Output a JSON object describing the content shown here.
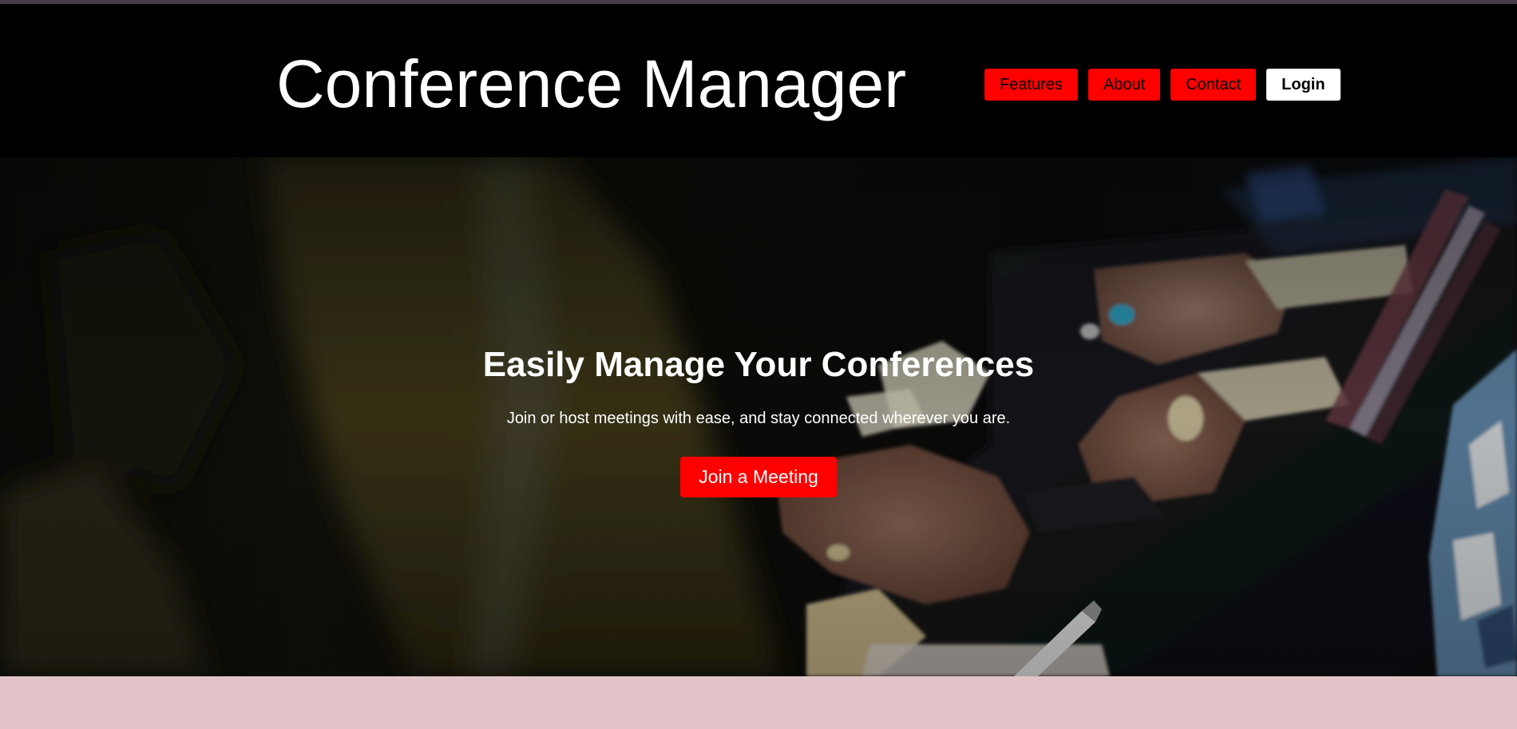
{
  "header": {
    "title": "Conference Manager",
    "nav": [
      {
        "label": "Features"
      },
      {
        "label": "About"
      },
      {
        "label": "Contact"
      }
    ],
    "login_label": "Login"
  },
  "hero": {
    "heading": "Easily Manage Your Conferences",
    "subheading": "Join or host meetings with ease, and stay connected wherever you are.",
    "cta_label": "Join a Meeting"
  },
  "colors": {
    "header_bg": "#000000",
    "accent": "#ff0000",
    "footer_band": "#e2c4c8"
  }
}
